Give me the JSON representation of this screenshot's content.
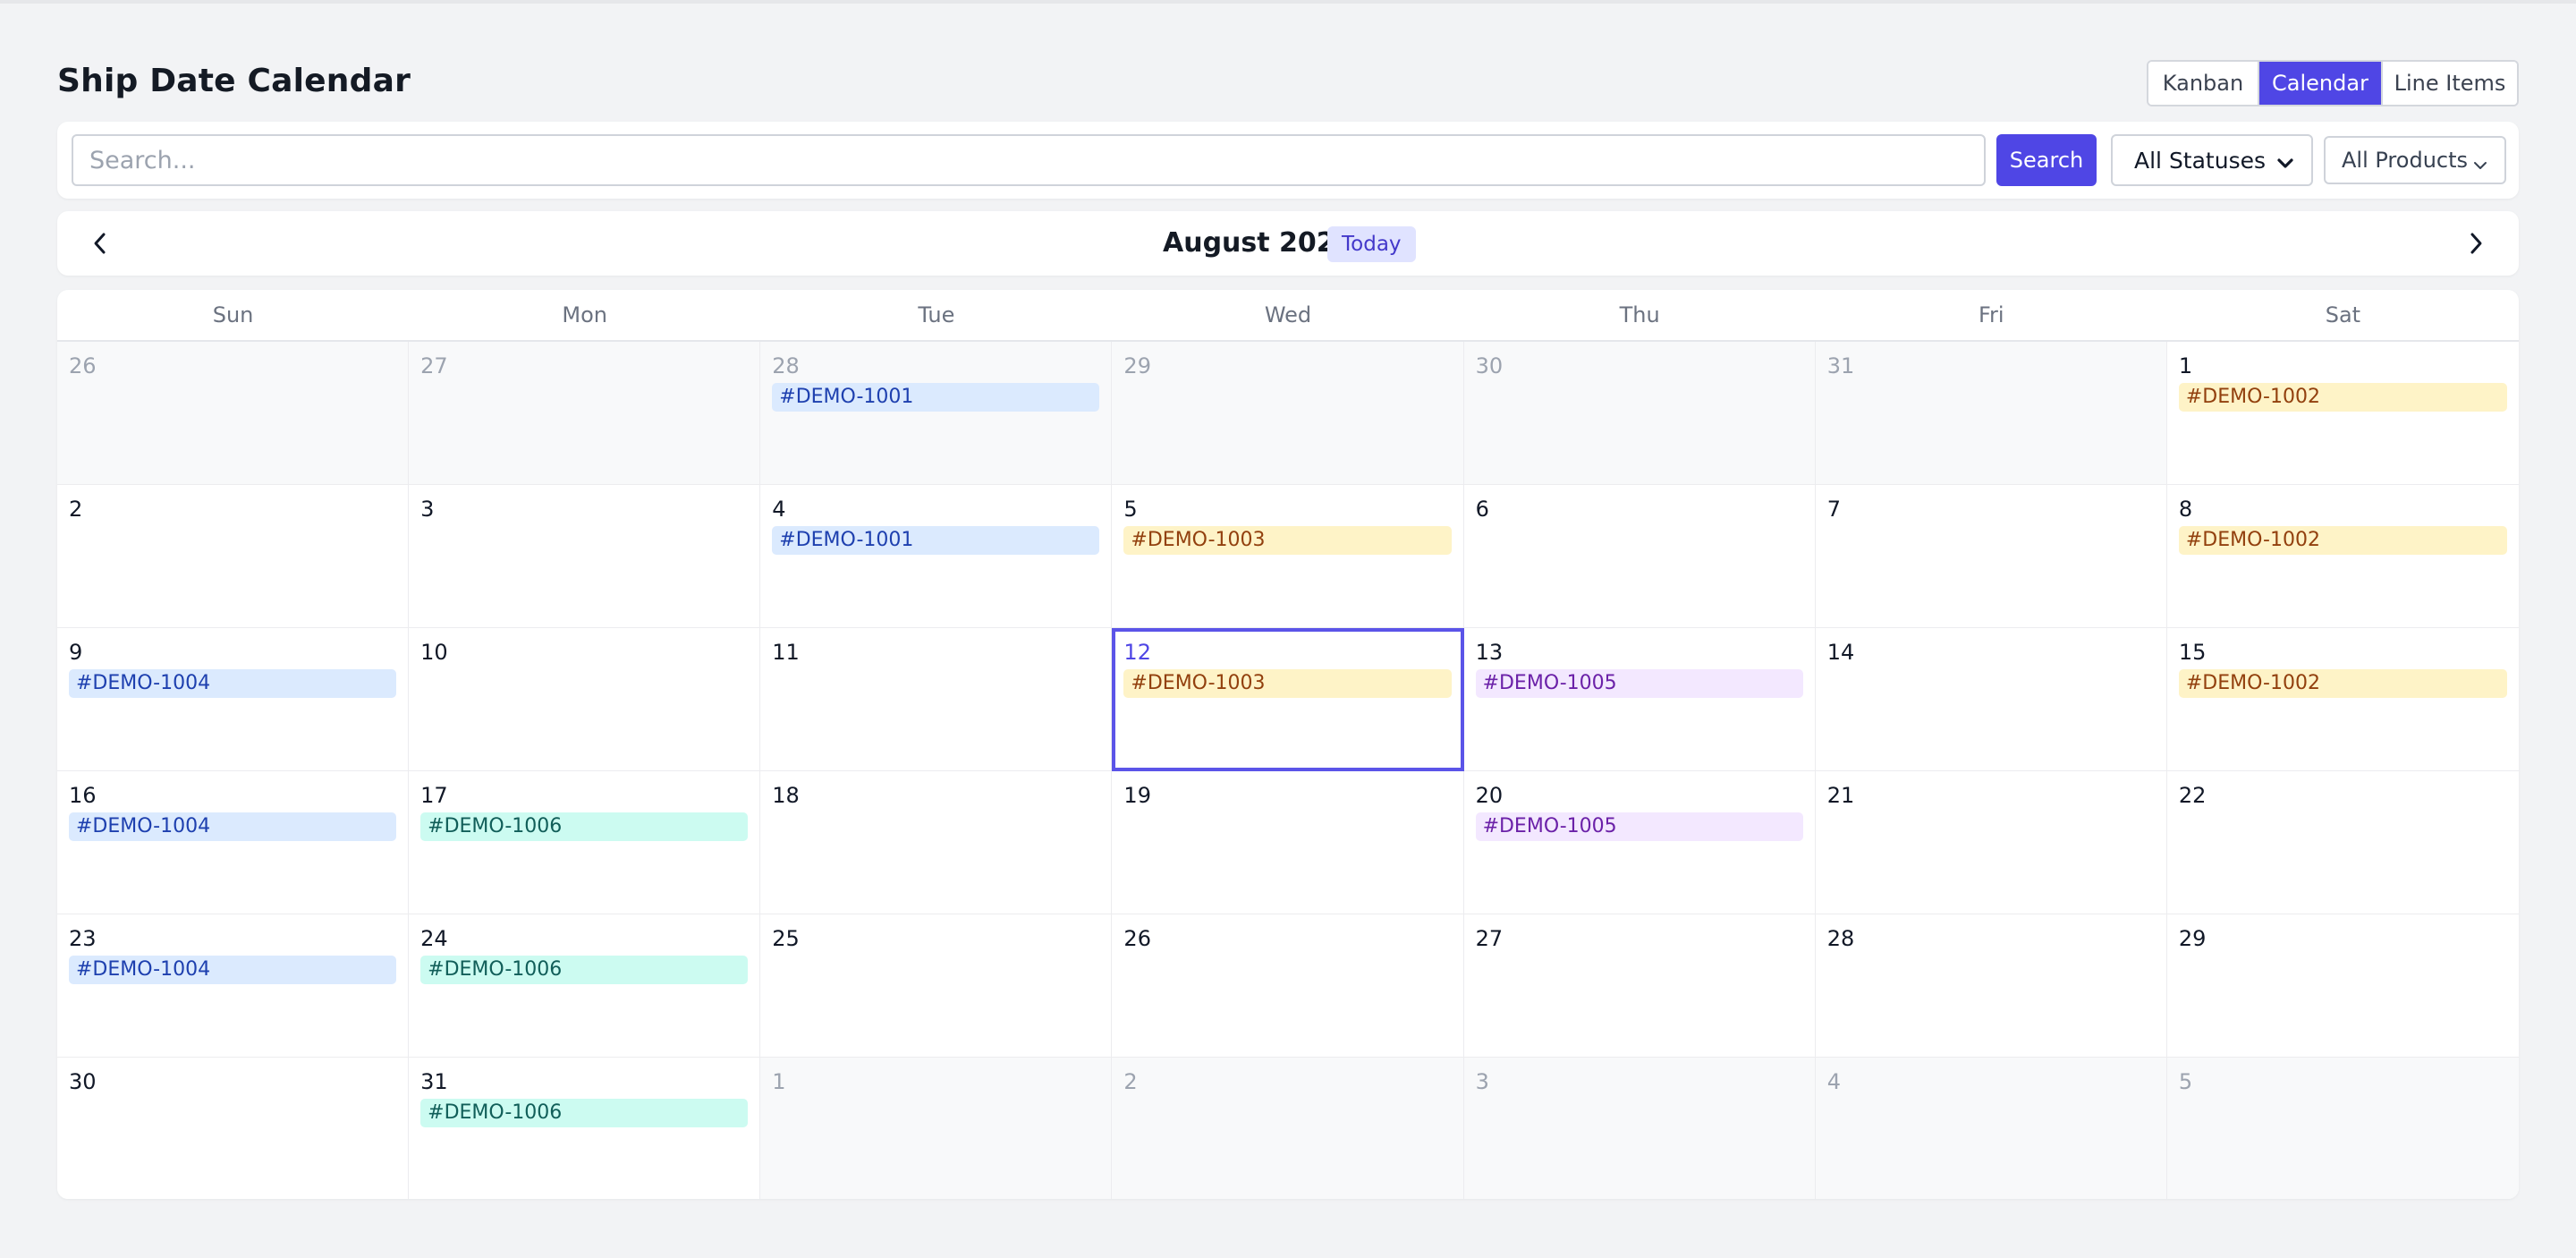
{
  "page": {
    "title": "Ship Date Calendar"
  },
  "views": [
    "Kanban",
    "Calendar",
    "Line Items"
  ],
  "active_view": "Calendar",
  "filters": {
    "search_placeholder": "Search...",
    "search_button": "Search",
    "status_value": "All Statuses",
    "product_value": "All Products"
  },
  "nav": {
    "month_label": "August 2026",
    "today_label": "Today"
  },
  "weekdays": [
    "Sun",
    "Mon",
    "Tue",
    "Wed",
    "Thu",
    "Fri",
    "Sat"
  ],
  "event_colors": {
    "blue": {
      "bg": "#dbeafe",
      "text": "#1e40af"
    },
    "yellow": {
      "bg": "#fef3c7",
      "text": "#92400e"
    },
    "purple": {
      "bg": "#f3e8ff",
      "text": "#6b21a8"
    },
    "green": {
      "bg": "#ccfbf1",
      "text": "#115e59"
    }
  },
  "accent_color": "#4f46e5",
  "days": [
    {
      "day": "26",
      "outside": true,
      "events": []
    },
    {
      "day": "27",
      "outside": true,
      "events": []
    },
    {
      "day": "28",
      "outside": true,
      "events": [
        {
          "label": "#DEMO-1001",
          "color": "blue"
        }
      ]
    },
    {
      "day": "29",
      "outside": true,
      "events": []
    },
    {
      "day": "30",
      "outside": true,
      "events": []
    },
    {
      "day": "31",
      "outside": true,
      "events": []
    },
    {
      "day": "1",
      "outside": false,
      "events": [
        {
          "label": "#DEMO-1002",
          "color": "yellow"
        }
      ]
    },
    {
      "day": "2",
      "outside": false,
      "events": []
    },
    {
      "day": "3",
      "outside": false,
      "events": []
    },
    {
      "day": "4",
      "outside": false,
      "events": [
        {
          "label": "#DEMO-1001",
          "color": "blue"
        }
      ]
    },
    {
      "day": "5",
      "outside": false,
      "events": [
        {
          "label": "#DEMO-1003",
          "color": "yellow"
        }
      ]
    },
    {
      "day": "6",
      "outside": false,
      "events": []
    },
    {
      "day": "7",
      "outside": false,
      "events": []
    },
    {
      "day": "8",
      "outside": false,
      "events": [
        {
          "label": "#DEMO-1002",
          "color": "yellow"
        }
      ]
    },
    {
      "day": "9",
      "outside": false,
      "events": [
        {
          "label": "#DEMO-1004",
          "color": "blue"
        }
      ]
    },
    {
      "day": "10",
      "outside": false,
      "events": []
    },
    {
      "day": "11",
      "outside": false,
      "events": []
    },
    {
      "day": "12",
      "outside": false,
      "selected": true,
      "events": [
        {
          "label": "#DEMO-1003",
          "color": "yellow"
        }
      ]
    },
    {
      "day": "13",
      "outside": false,
      "events": [
        {
          "label": "#DEMO-1005",
          "color": "purple"
        }
      ]
    },
    {
      "day": "14",
      "outside": false,
      "events": []
    },
    {
      "day": "15",
      "outside": false,
      "events": [
        {
          "label": "#DEMO-1002",
          "color": "yellow"
        }
      ]
    },
    {
      "day": "16",
      "outside": false,
      "events": [
        {
          "label": "#DEMO-1004",
          "color": "blue"
        }
      ]
    },
    {
      "day": "17",
      "outside": false,
      "events": [
        {
          "label": "#DEMO-1006",
          "color": "green"
        }
      ]
    },
    {
      "day": "18",
      "outside": false,
      "events": []
    },
    {
      "day": "19",
      "outside": false,
      "events": []
    },
    {
      "day": "20",
      "outside": false,
      "events": [
        {
          "label": "#DEMO-1005",
          "color": "purple"
        }
      ]
    },
    {
      "day": "21",
      "outside": false,
      "events": []
    },
    {
      "day": "22",
      "outside": false,
      "events": []
    },
    {
      "day": "23",
      "outside": false,
      "events": [
        {
          "label": "#DEMO-1004",
          "color": "blue"
        }
      ]
    },
    {
      "day": "24",
      "outside": false,
      "events": [
        {
          "label": "#DEMO-1006",
          "color": "green"
        }
      ]
    },
    {
      "day": "25",
      "outside": false,
      "events": []
    },
    {
      "day": "26",
      "outside": false,
      "events": []
    },
    {
      "day": "27",
      "outside": false,
      "events": []
    },
    {
      "day": "28",
      "outside": false,
      "events": []
    },
    {
      "day": "29",
      "outside": false,
      "events": []
    },
    {
      "day": "30",
      "outside": false,
      "events": []
    },
    {
      "day": "31",
      "outside": false,
      "events": [
        {
          "label": "#DEMO-1006",
          "color": "green"
        }
      ]
    },
    {
      "day": "1",
      "outside": true,
      "events": []
    },
    {
      "day": "2",
      "outside": true,
      "events": []
    },
    {
      "day": "3",
      "outside": true,
      "events": []
    },
    {
      "day": "4",
      "outside": true,
      "events": []
    },
    {
      "day": "5",
      "outside": true,
      "events": []
    }
  ]
}
